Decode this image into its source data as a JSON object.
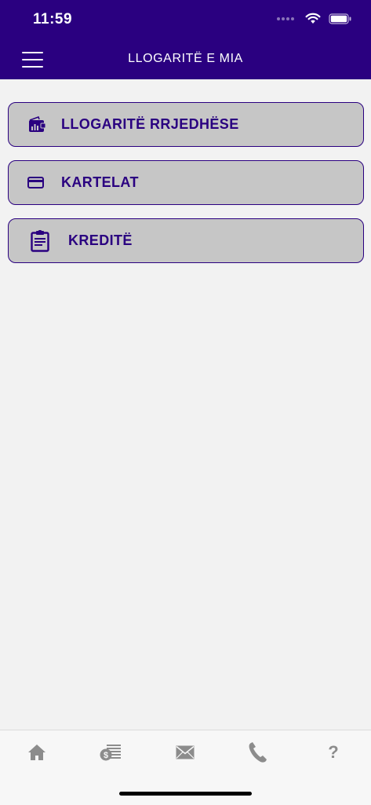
{
  "status_bar": {
    "time": "11:59"
  },
  "header": {
    "title": "LLOGARITË E MIA"
  },
  "menu": [
    {
      "label": "LLOGARITË RRJEDHËSE",
      "icon": "wallet-chart-icon"
    },
    {
      "label": "KARTELAT",
      "icon": "credit-card-icon"
    },
    {
      "label": "KREDITË",
      "icon": "clipboard-icon"
    }
  ],
  "tabbar": {
    "items": [
      {
        "icon": "home-icon"
      },
      {
        "icon": "money-list-icon"
      },
      {
        "icon": "mail-icon"
      },
      {
        "icon": "phone-icon"
      },
      {
        "icon": "help-icon",
        "text": "?"
      }
    ]
  },
  "colors": {
    "brand": "#2a0080",
    "card_bg": "#c6c6c6",
    "page_bg": "#f2f2f2",
    "tab_icon": "#8c8c8c"
  }
}
